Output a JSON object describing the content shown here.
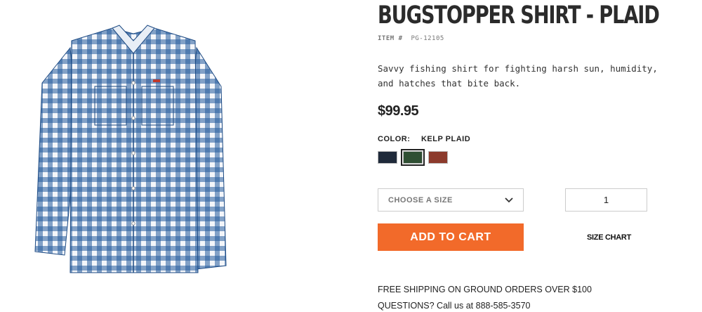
{
  "product": {
    "title": "BUGSTOPPER SHIRT - PLAID",
    "item_label": "ITEM #",
    "item_number": "PG-12105",
    "description": "Savvy fishing shirt for fighting harsh sun, humidity, and hatches that bite back.",
    "price": "$99.95",
    "image_icon": "plaid-shirt-image"
  },
  "color": {
    "label": "COLOR:",
    "selected": "KELP PLAID",
    "swatches": [
      {
        "name": "navy",
        "hex": "#1f2a3a",
        "selected": false
      },
      {
        "name": "kelp",
        "hex": "#2f4f33",
        "selected": true
      },
      {
        "name": "red",
        "hex": "#8c3a2c",
        "selected": false
      }
    ]
  },
  "size": {
    "placeholder": "CHOOSE A SIZE",
    "icon": "chevron-down-icon"
  },
  "quantity": {
    "value": "1"
  },
  "actions": {
    "add_to_cart": "ADD TO CART",
    "size_chart": "SIZE CHART"
  },
  "info": {
    "shipping": "FREE SHIPPING ON GROUND ORDERS OVER $100",
    "questions": "QUESTIONS? Call us at 888-585-3570"
  },
  "colors": {
    "accent": "#f26a2a",
    "plaid_blue": "#245a9c"
  }
}
